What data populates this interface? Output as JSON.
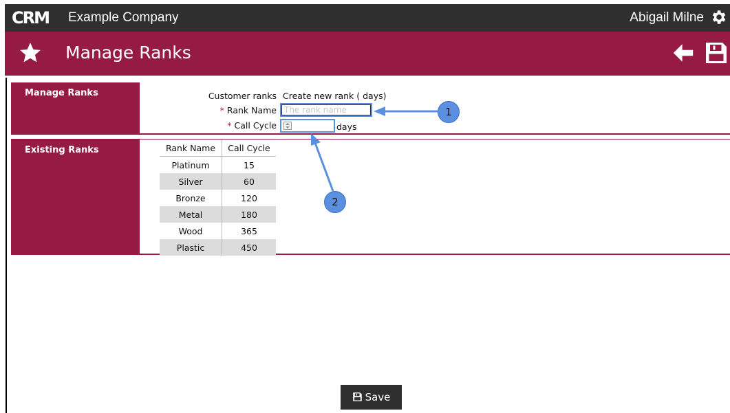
{
  "header": {
    "logo_text": "CRM",
    "company": "Example Company",
    "user": "Abigail Milne"
  },
  "titlebar": {
    "title": "Manage Ranks"
  },
  "manage_section": {
    "label": "Manage Ranks",
    "customer_ranks_label": "Customer ranks",
    "customer_ranks_value": "Create new rank ( days)",
    "rank_name_label": "Rank Name",
    "rank_name_placeholder": "The rank name",
    "call_cycle_label": "Call Cycle",
    "call_cycle_unit": "days"
  },
  "existing_section": {
    "label": "Existing Ranks",
    "columns": [
      "Rank Name",
      "Call Cycle"
    ],
    "rows": [
      [
        "Platinum",
        "15"
      ],
      [
        "Silver",
        "60"
      ],
      [
        "Bronze",
        "120"
      ],
      [
        "Metal",
        "180"
      ],
      [
        "Wood",
        "365"
      ],
      [
        "Plastic",
        "450"
      ]
    ]
  },
  "callouts": [
    "1",
    "2"
  ],
  "footer": {
    "save_label": "Save"
  },
  "colors": {
    "accent": "#951b45",
    "topbar": "#2f2f2f",
    "callout": "#5b8fe0"
  },
  "icons": [
    "star-icon",
    "gear-icon",
    "back-arrow-icon",
    "save-icon"
  ]
}
